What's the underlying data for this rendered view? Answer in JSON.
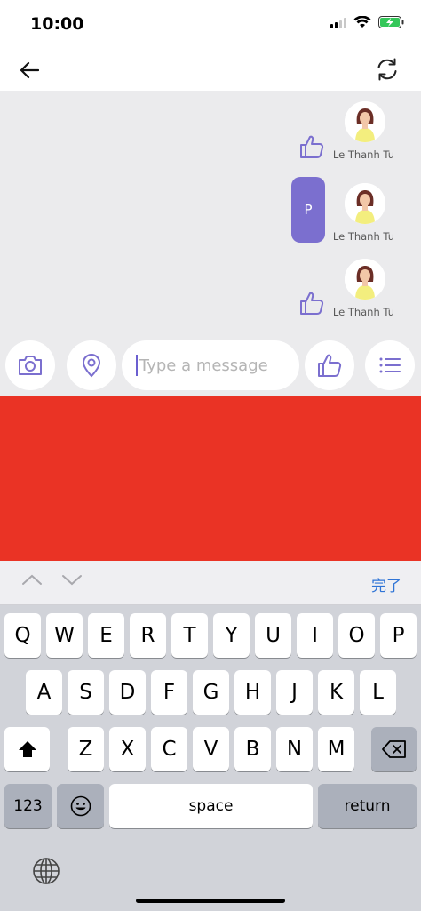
{
  "status": {
    "time": "10:00"
  },
  "messages": [
    {
      "sender": "Le Thanh Tu",
      "type": "like"
    },
    {
      "sender": "Le Thanh Tu",
      "type": "text",
      "text": "P"
    },
    {
      "sender": "Le Thanh Tu",
      "type": "like"
    }
  ],
  "input": {
    "placeholder": "Type a message"
  },
  "keyboard": {
    "done_label": "完了",
    "row1": [
      "Q",
      "W",
      "E",
      "R",
      "T",
      "Y",
      "U",
      "I",
      "O",
      "P"
    ],
    "row2": [
      "A",
      "S",
      "D",
      "F",
      "G",
      "H",
      "J",
      "K",
      "L"
    ],
    "row3": [
      "Z",
      "X",
      "C",
      "V",
      "B",
      "N",
      "M"
    ],
    "numbers_label": "123",
    "space_label": "space",
    "return_label": "return"
  },
  "colors": {
    "accent": "#7b6fcf",
    "panel_red": "#ea3325",
    "chat_bg": "#ebebed",
    "done_blue": "#2f74d6"
  }
}
